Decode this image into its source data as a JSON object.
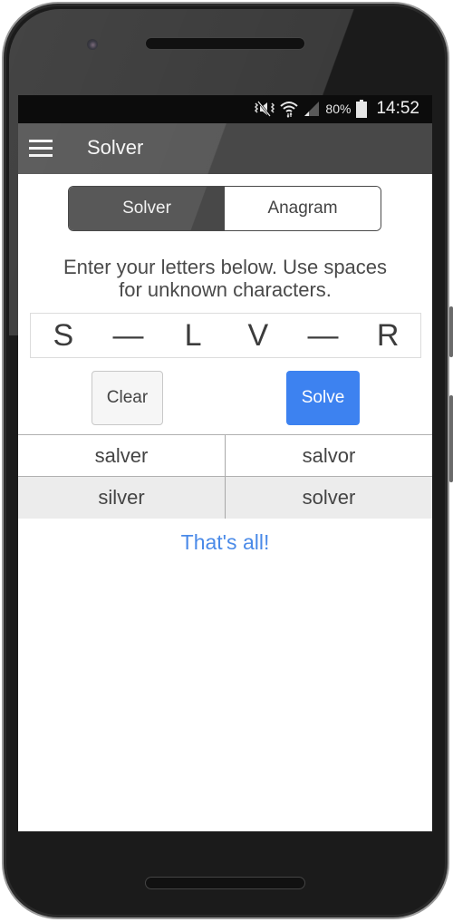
{
  "status_bar": {
    "icons": [
      "vibrate-mute-icon",
      "wifi-icon",
      "cell-signal-icon",
      "battery-icon"
    ],
    "battery": "80%",
    "time": "14:52"
  },
  "app_bar": {
    "menu_icon": "hamburger-menu-icon",
    "title": "Solver"
  },
  "mode_tabs": [
    {
      "label": "Solver",
      "active": true
    },
    {
      "label": "Anagram",
      "active": false
    }
  ],
  "instructions": {
    "line1": "Enter your letters below. Use spaces",
    "line2": "for unknown characters."
  },
  "letter_input": {
    "slots": [
      "S",
      "—",
      "L",
      "V",
      "—",
      "R"
    ]
  },
  "buttons": {
    "clear": "Clear",
    "solve": "Solve"
  },
  "colors": {
    "accent": "#3d82f0",
    "app_bar": "#484848",
    "end_text": "#4a8ae8"
  },
  "results": {
    "rows": [
      [
        "salver",
        "salvor"
      ],
      [
        "silver",
        "solver"
      ]
    ],
    "end_message": "That's all!"
  }
}
